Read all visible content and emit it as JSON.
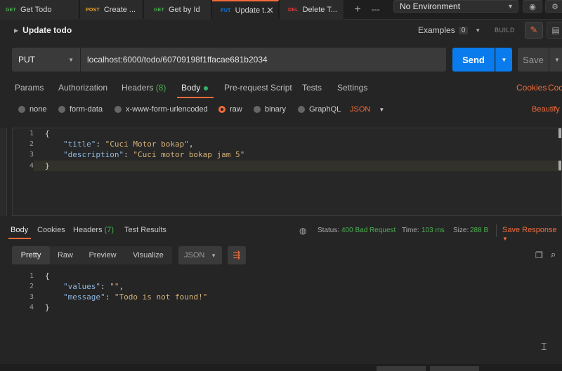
{
  "tabs": [
    {
      "method": "GET",
      "label": "Get Todo",
      "color": "#4caf50"
    },
    {
      "method": "POST",
      "label": "Create ...",
      "color": "#f5a623"
    },
    {
      "method": "GET",
      "label": "Get by Id",
      "color": "#4caf50"
    },
    {
      "method": "PUT",
      "label": "Update t...",
      "color": "#097bed"
    },
    {
      "method": "DEL",
      "label": "Delete T...",
      "color": "#e53935"
    }
  ],
  "tab_close_glyph": "✕",
  "tab_add_glyph": "+",
  "tab_more_glyph": "∘∘∘",
  "environment": "No Environment",
  "request": {
    "title": "Update todo",
    "examples_label": "Examples",
    "examples_count": "0",
    "build_label": "BUILD",
    "method": "PUT",
    "url": "localhost:6000/todo/60709198f1ffacae681b2034",
    "send_label": "Send",
    "save_label": "Save"
  },
  "request_tabs": {
    "params": "Params",
    "authorization": "Authorization",
    "headers": "Headers",
    "headers_count": "(8)",
    "body": "Body",
    "pre_request": "Pre-request Script",
    "tests": "Tests",
    "settings": "Settings",
    "cookies": "Cookies",
    "code": "Cod"
  },
  "body_types": {
    "none": "none",
    "form_data": "form-data",
    "urlencoded": "x-www-form-urlencoded",
    "raw": "raw",
    "binary": "binary",
    "graphql": "GraphQL",
    "format": "JSON",
    "beautify": "Beautify",
    "selected": "raw"
  },
  "request_body": {
    "line_numbers": [
      "1",
      "2",
      "3",
      "4"
    ],
    "open_brace": "{",
    "close_brace": "}",
    "title_key": "\"title\"",
    "title_value": "\"Cuci Motor bokap\"",
    "description_key": "\"description\"",
    "description_value": "\"Cuci motor bokap jam 5\""
  },
  "response_tabs": {
    "body": "Body",
    "cookies": "Cookies",
    "headers": "Headers",
    "headers_count": "(7)",
    "test_results": "Test Results"
  },
  "response_status": {
    "status_label": "Status:",
    "status_value": "400 Bad Request",
    "time_label": "Time:",
    "time_value": "103 ms",
    "size_label": "Size:",
    "size_value": "288 B",
    "save_response": "Save Response"
  },
  "response_view": {
    "pretty": "Pretty",
    "raw": "Raw",
    "preview": "Preview",
    "visualize": "Visualize",
    "format": "JSON"
  },
  "response_body": {
    "line_numbers": [
      "1",
      "2",
      "3",
      "4"
    ],
    "open_brace": "{",
    "close_brace": "}",
    "values_key": "\"values\"",
    "values_value": "\"\"",
    "message_key": "\"message\"",
    "message_value": "\"Todo is not found!\""
  },
  "colors": {
    "accent": "#f26b3a",
    "send": "#097bed",
    "success": "#4caf50"
  }
}
